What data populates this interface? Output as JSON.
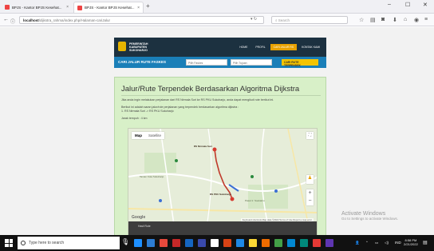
{
  "browser": {
    "tabs": [
      {
        "label": "BPJS - Kantor BPJS Kesehat..."
      },
      {
        "label": "BPJS - Kantor BPJS Kesehat..."
      }
    ],
    "new_tab": "+",
    "url_host": "localhost",
    "url_path": "/dijkstra_rahma/index.php/Halaman-cariJalur",
    "search_placeholder": "Search",
    "window": {
      "minimize": "–",
      "maximize": "☐",
      "close": "✕"
    }
  },
  "site": {
    "logo_text": [
      "PEMERINTAH",
      "KABUPATEN",
      "SUKOHARJO"
    ],
    "menu": [
      "HOME",
      "PROFIL",
      "CARI JALUR RS",
      "KONTAK KAMI"
    ],
    "menu_active_index": 2,
    "subbar_title": "CARI JALUR RUTE FASKES",
    "select1": "Pilih Faskes",
    "select2": "Pilih Tujuan",
    "search_button": "CARI RUTE TERPENDEK"
  },
  "content": {
    "title": "Jalur/Rute Terpendek Berdasarkan Algoritma Dijkstra",
    "para1": "Jika anda ingin melakukan perjalanan dari RS Nirmala Suri ke RS PKU Sukoharjo, anda dapat mengikuti rute berikut ini.",
    "para2": "Berikut ini adalah saran jalur/rute perjalanan yang terpendek berdasarkan algoritma dijkstra :",
    "para3": "1. RS Nirmala Suri -> RS PKU Sukoharjo",
    "para4": "Jarak tempuh : 4 km"
  },
  "map": {
    "tab_map": "Map",
    "tab_satellite": "Satellite",
    "zoom_in": "+",
    "zoom_out": "−",
    "google": "Google",
    "attribution": "Keyboard shortcuts   Map data ©2022   Terms of Use   Report a map error",
    "labels": [
      "RS Nirmala Suri",
      "RS PKU Sukoharjo",
      "Taman Kota Sukoharjo",
      "Pasar Ir. Soekarno"
    ],
    "footer": "Hasil Rute"
  },
  "activate_windows": {
    "line1": "Activate Windows",
    "line2": "Go to Settings to activate Windows."
  },
  "taskbar": {
    "search_placeholder": "Type here to search",
    "time": "8:58 PM",
    "date": "2/21/2022"
  }
}
